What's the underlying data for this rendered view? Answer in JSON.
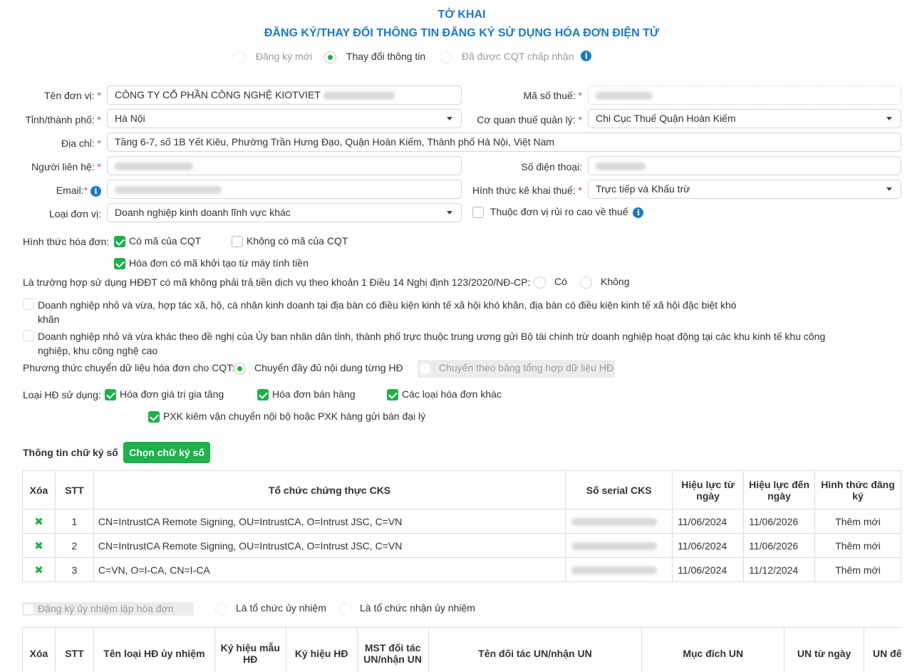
{
  "header": {
    "title": "TỜ KHAI",
    "subtitle": "ĐĂNG KÝ/THAY ĐỔI THÔNG TIN ĐĂNG KÝ SỬ DỤNG HÓA ĐƠN ĐIỆN TỬ",
    "modes": [
      {
        "label": "Đăng ký mới",
        "selected": false
      },
      {
        "label": "Thay đổi thông tin",
        "selected": true
      },
      {
        "label": "Đã được CQT chấp nhận",
        "selected": false
      }
    ]
  },
  "form": {
    "ten_don_vi": {
      "label": "Tên đơn vị:",
      "value": "CÔNG TY CỔ PHẦN CÔNG NGHỆ KIOTVIET"
    },
    "ma_so_thue": {
      "label": "Mã số thuế:"
    },
    "tinh_thanh_pho": {
      "label": "Tỉnh/thành phố:",
      "value": "Hà Nội"
    },
    "co_quan_thue": {
      "label": "Cơ quan thuế quản lý:",
      "value": "Chi Cục Thuế Quận Hoàn Kiếm"
    },
    "dia_chi": {
      "label": "Địa chỉ:",
      "value": "Tầng 6-7, số 1B Yết Kiêu, Phường Trần Hưng Đạo, Quận Hoàn Kiếm, Thành phố Hà Nội, Việt Nam"
    },
    "nguoi_lien_he": {
      "label": "Người liên hệ:"
    },
    "so_dien_thoai": {
      "label": "Số điện thoại:"
    },
    "email": {
      "label": "Email:"
    },
    "hinh_thuc_ke_khai": {
      "label": "Hình thức kê khai thuế:",
      "value": "Trực tiếp và Khấu trừ"
    },
    "loai_don_vi": {
      "label": "Loại đơn vị:",
      "value": "Doanh nghiệp kinh doanh lĩnh vực khác"
    },
    "rui_ro_cao": {
      "label": "Thuộc đơn vị rủi ro cao về thuế",
      "checked": false
    }
  },
  "invoice_form": {
    "label": "Hình thức hóa đơn:",
    "co_ma": {
      "label": "Có mã của CQT",
      "checked": true
    },
    "khong_co_ma": {
      "label": "Không có mã của CQT",
      "checked": false
    },
    "may_tinh_tien": {
      "label": "Hóa đơn có mã khởi tạo từ máy tính tiền",
      "checked": true
    }
  },
  "free_service": {
    "question": "Là trường hợp sử dụng HĐĐT có mã không phải trả tiền dịch vụ theo khoản 1 Điều 14 Nghị định 123/2020/NĐ-CP:",
    "yes": "Có",
    "no": "Không",
    "option1": "Doanh nghiệp nhỏ và vừa, hợp tác xã, hộ, cá nhân kinh doanh tại địa bàn có điều kiện kinh tế xã hội khó khăn, địa bàn có điều kiện kinh tế xã hội đặc biệt khó khăn",
    "option2": "Doanh nghiệp nhỏ và vừa khác theo đề nghị của Ủy ban nhân dân tỉnh, thành phố trực thuộc trung ương gửi Bộ tài chính trừ doanh nghiệp hoạt động tại các khu kinh tế khu công nghiệp, khu công nghệ cao"
  },
  "transfer": {
    "label": "Phương thức chuyển dữ liệu hóa đơn cho CQT:",
    "full": "Chuyển đầy đủ nội dung từng HĐ",
    "summary": "Chuyển theo bảng tổng hợp dữ liệu HĐ"
  },
  "invoice_types": {
    "label": "Loại HĐ sử dụng:",
    "gtgt": "Hóa đơn giá trị gia tăng",
    "ban_hang": "Hóa đơn bán hàng",
    "khac": "Các loại hóa đơn khác",
    "pxk": "PXK kiêm vận chuyển nội bộ hoặc PXK hàng gửi bán đại lý"
  },
  "signature": {
    "title": "Thông tin chữ ký số",
    "button": "Chọn chữ ký số",
    "columns": [
      "Xóa",
      "STT",
      "Tổ chức chứng thực CKS",
      "Số serial CKS",
      "Hiệu lực từ ngày",
      "Hiệu lực đến ngày",
      "Hình thức đăng ký"
    ],
    "rows": [
      {
        "stt": "1",
        "org": "CN=IntrustCA Remote Signing, OU=IntrustCA, O=Intrust JSC, C=VN",
        "from": "11/06/2024",
        "to": "11/06/2026",
        "type": "Thêm mới"
      },
      {
        "stt": "2",
        "org": "CN=IntrustCA Remote Signing, OU=IntrustCA, O=Intrust JSC, C=VN",
        "from": "11/06/2024",
        "to": "11/06/2026",
        "type": "Thêm mới"
      },
      {
        "stt": "3",
        "org": "C=VN, O=I-CA, CN=I-CA",
        "from": "11/06/2024",
        "to": "11/12/2024",
        "type": "Thêm mới"
      }
    ]
  },
  "delegation": {
    "register": "Đăng ký ủy nhiệm lập hóa đơn",
    "delegating_org": "Là tổ chức ủy nhiệm",
    "receiving_org": "Là tổ chức nhận ủy nhiệm",
    "columns": [
      "Xóa",
      "STT",
      "Tên loại HĐ ủy nhiệm",
      "Ký hiệu mẫu HĐ",
      "Ký hiệu HĐ",
      "MST đối tác UN/nhận UN",
      "Tên đối tác UN/nhận UN",
      "Mục đích UN",
      "UN từ ngày",
      "UN đến ngày"
    ]
  }
}
